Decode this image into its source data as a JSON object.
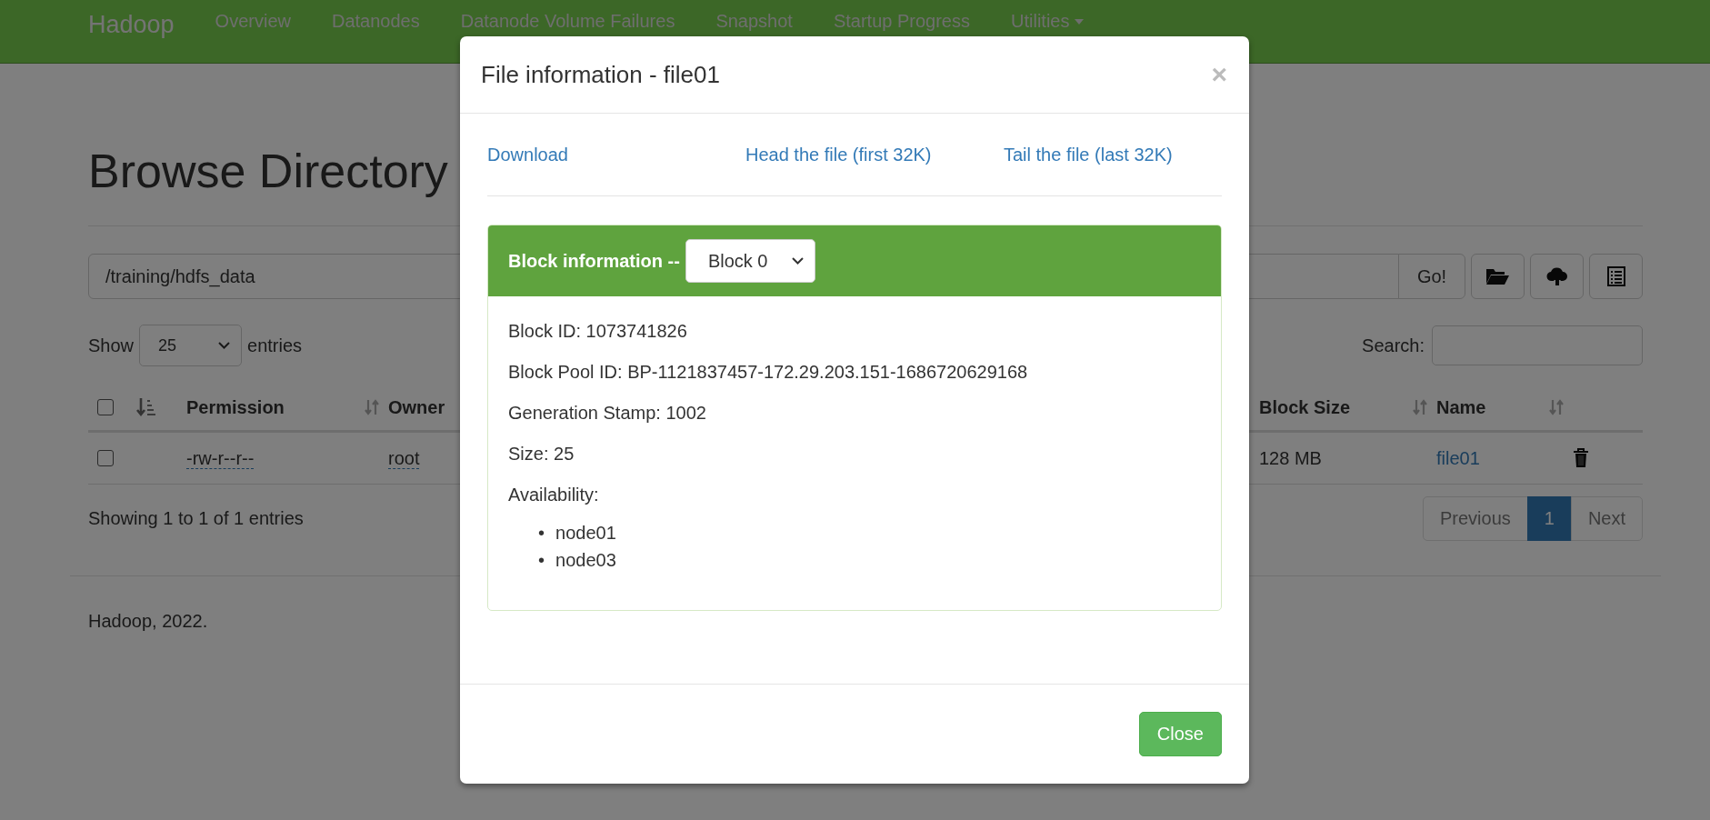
{
  "navbar": {
    "brand": "Hadoop",
    "items": [
      {
        "label": "Overview",
        "dropdown": false
      },
      {
        "label": "Datanodes",
        "dropdown": false
      },
      {
        "label": "Datanode Volume Failures",
        "dropdown": false
      },
      {
        "label": "Snapshot",
        "dropdown": false
      },
      {
        "label": "Startup Progress",
        "dropdown": false
      },
      {
        "label": "Utilities",
        "dropdown": true
      }
    ]
  },
  "page": {
    "title": "Browse Directory",
    "path_field": {
      "value": "/training/hdfs_data"
    },
    "go_button": "Go!",
    "length": {
      "before": "Show",
      "value": "25",
      "after": "entries"
    },
    "search": {
      "label": "Search:"
    },
    "table": {
      "select_all": {
        "checked": false
      },
      "columns": [
        {
          "label": "Permission",
          "sort_icon": true
        },
        {
          "label": "Owner",
          "sort_icon": false
        },
        {
          "label": "Block Size",
          "sort_icon": true
        },
        {
          "label": "Name",
          "sort_icon": true
        }
      ],
      "rows": [
        {
          "checked": false,
          "cells": [
            {
              "text": "-rw-r--r--",
              "kind": "abbr"
            },
            {
              "text": "root",
              "kind": "abbr"
            },
            {
              "text": "128 MB",
              "kind": "text"
            },
            {
              "text": "file01",
              "kind": "link"
            }
          ]
        }
      ]
    },
    "info": "Showing 1 to 1 of 1 entries",
    "pagination": [
      {
        "label": "Previous",
        "selected": false,
        "disabled": true
      },
      {
        "label": "1",
        "selected": true,
        "disabled": false
      },
      {
        "label": "Next",
        "selected": false,
        "disabled": true
      }
    ],
    "footer": "Hadoop, 2022."
  },
  "modal": {
    "title": "File information - file01",
    "close_icon": "×",
    "links": [
      "Download",
      "Head the file (first 32K)",
      "Tail the file (last 32K)"
    ],
    "block": {
      "heading": "Block information --",
      "select": "Block 0",
      "details": [
        "Block ID: 1073741826",
        "Block Pool ID: BP-1121837457-172.29.203.151-1686720629168",
        "Generation Stamp: 1002",
        "Size: 25"
      ],
      "availability_label": "Availability:",
      "nodes": [
        {
          "marker": "•",
          "text": "node01"
        },
        {
          "marker": "•",
          "text": "node03"
        }
      ]
    },
    "close_button": "Close"
  }
}
